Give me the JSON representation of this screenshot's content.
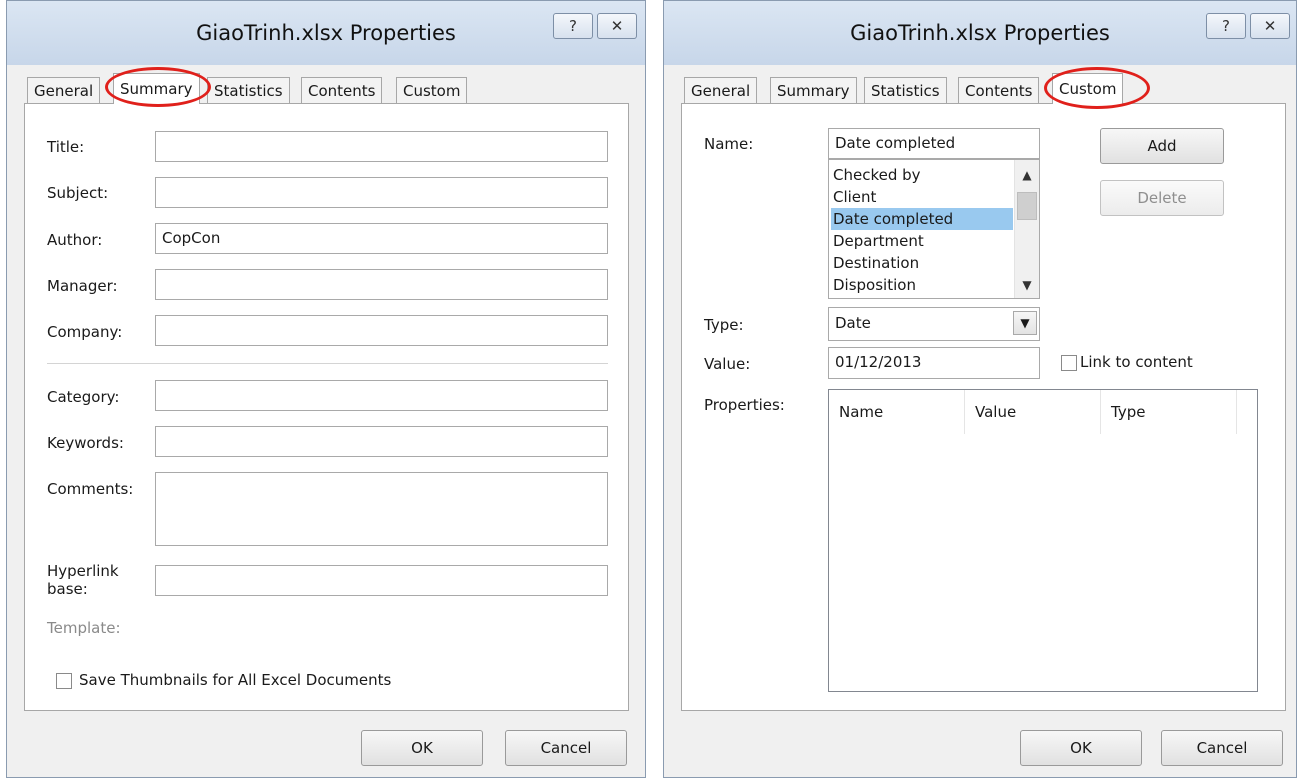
{
  "left_dialog": {
    "title": "GiaoTrinh.xlsx Properties",
    "help_label": "?",
    "close_label": "✕",
    "tabs": [
      {
        "label": "General"
      },
      {
        "label": "Summary"
      },
      {
        "label": "Statistics"
      },
      {
        "label": "Contents"
      },
      {
        "label": "Custom"
      }
    ],
    "active_tab": "Summary",
    "fields": {
      "title_label": "Title:",
      "title_value": "",
      "subject_label": "Subject:",
      "subject_value": "",
      "author_label": "Author:",
      "author_value": "CopCon",
      "manager_label": "Manager:",
      "manager_value": "",
      "company_label": "Company:",
      "company_value": "",
      "category_label": "Category:",
      "category_value": "",
      "keywords_label": "Keywords:",
      "keywords_value": "",
      "comments_label": "Comments:",
      "comments_value": "",
      "hyperlink_label_1": "Hyperlink",
      "hyperlink_label_2": "base:",
      "hyperlink_value": "",
      "template_label": "Template:"
    },
    "thumbnail_checkbox_label": "Save Thumbnails for All Excel Documents",
    "thumbnail_checked": false,
    "ok_label": "OK",
    "cancel_label": "Cancel"
  },
  "right_dialog": {
    "title": "GiaoTrinh.xlsx Properties",
    "help_label": "?",
    "close_label": "✕",
    "tabs": [
      {
        "label": "General"
      },
      {
        "label": "Summary"
      },
      {
        "label": "Statistics"
      },
      {
        "label": "Contents"
      },
      {
        "label": "Custom"
      }
    ],
    "active_tab": "Custom",
    "name_label": "Name:",
    "name_value": "Date completed",
    "name_list": [
      {
        "label": "Checked by"
      },
      {
        "label": "Client"
      },
      {
        "label": "Date completed"
      },
      {
        "label": "Department"
      },
      {
        "label": "Destination"
      },
      {
        "label": "Disposition"
      }
    ],
    "selected_item": "Date completed",
    "add_label": "Add",
    "delete_label": "Delete",
    "type_label": "Type:",
    "type_value": "Date",
    "value_label": "Value:",
    "value_value": "01/12/2013",
    "link_label": "Link to content",
    "link_checked": false,
    "properties_label": "Properties:",
    "properties_columns": [
      {
        "label": "Name"
      },
      {
        "label": "Value"
      },
      {
        "label": "Type"
      }
    ],
    "ok_label": "OK",
    "cancel_label": "Cancel"
  },
  "highlight_color": "#e0201b",
  "selection_color": "#99c9ef"
}
